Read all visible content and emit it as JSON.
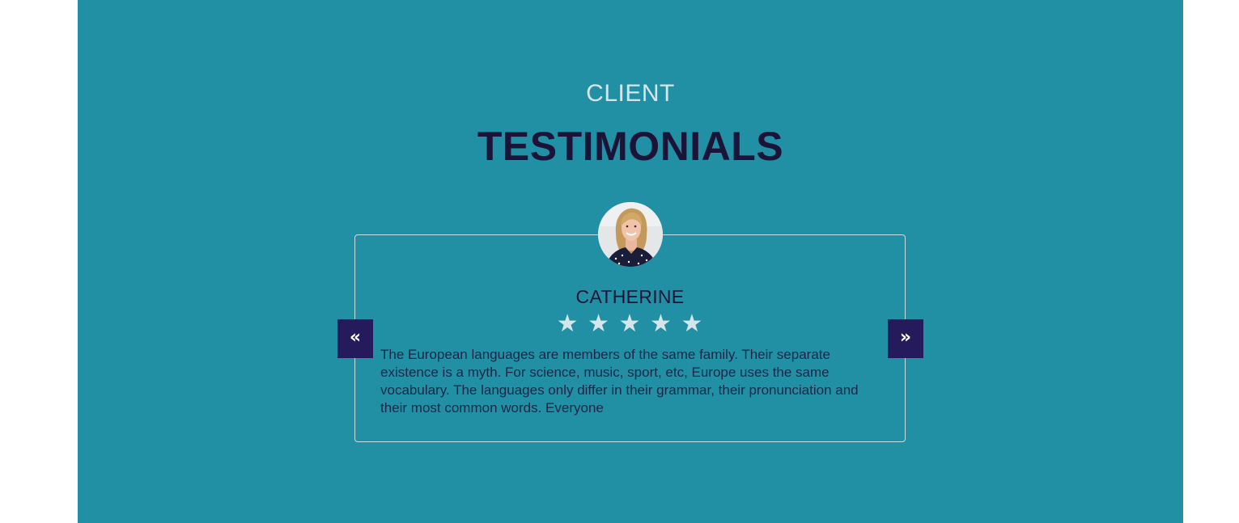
{
  "section": {
    "eyebrow": "CLIENT",
    "title": "TESTIMONIALS",
    "background_color": "#2290a4",
    "title_color": "#1b1438"
  },
  "testimonial": {
    "avatar_icon": "woman-portrait-photo",
    "name": "CATHERINE",
    "rating": 5,
    "stars": [
      "★",
      "★",
      "★",
      "★",
      "★"
    ],
    "text": "The European languages are members of the same family. Their separate existence is a myth. For science, music, sport, etc, Europe uses the same vocabulary. The languages only differ in their grammar, their pronunciation and their most common words. Everyone"
  },
  "navigation": {
    "prev_label": "«",
    "next_label": "»",
    "button_color": "#251b5c"
  }
}
